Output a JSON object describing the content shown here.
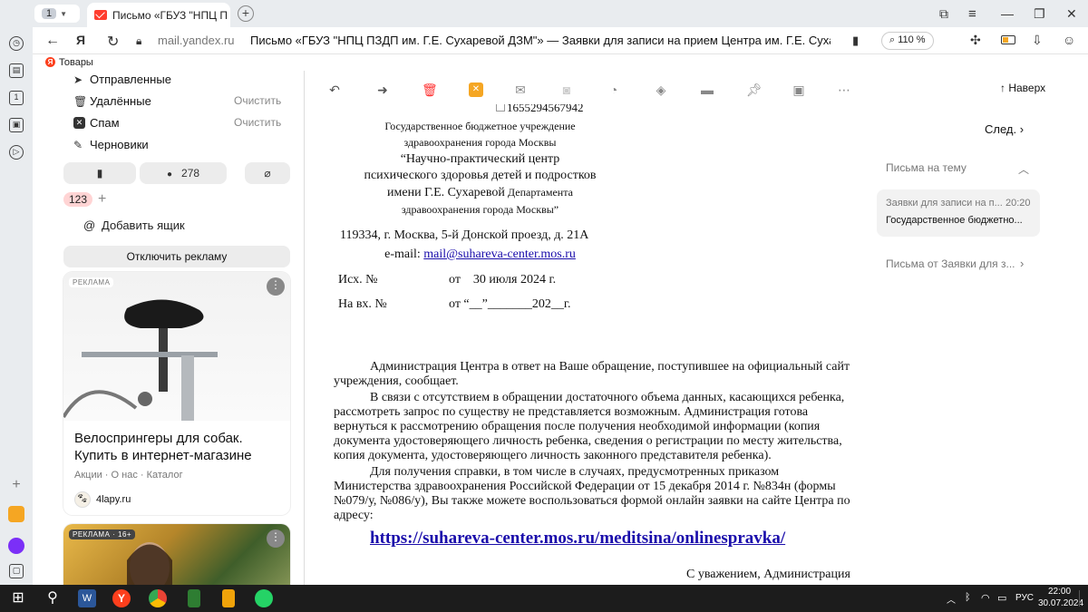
{
  "browser": {
    "tab_count": "1",
    "tab_title": "Письмо «ГБУЗ \"НПЦ П",
    "url_host": "mail.yandex.ru",
    "page_title": "Письмо «ГБУЗ \"НПЦ ПЗДП им. Г.Е. Сухаревой ДЗМ\"» — Заявки для записи на прием Центра им. Г.Е. Сухар...",
    "zoom": "110 %",
    "bookmark_label": "Товары"
  },
  "sidebar": {
    "folders": [
      {
        "label": "Отправленные",
        "icon": "send-icon"
      },
      {
        "label": "Удалённые",
        "icon": "trash-icon",
        "action": "Очистить"
      },
      {
        "label": "Спам",
        "icon": "spam-icon",
        "action": "Очистить"
      },
      {
        "label": "Черновики",
        "icon": "draft-icon"
      }
    ],
    "unread_count": "278",
    "counter_badge": "123",
    "add_box": "Добавить ящик",
    "disable_ads": "Отключить рекламу"
  },
  "ads": [
    {
      "label": "РЕКЛАМА",
      "title": "Велоспрингеры для собак. Купить в интернет-магазине",
      "links": "Акции · О нас · Каталог",
      "domain": "4lapy.ru"
    },
    {
      "label": "РЕКЛАМА · 16+"
    }
  ],
  "toolbar": {
    "up_label": "Наверх"
  },
  "letter": {
    "top_number": "1655294567942",
    "org_line1": "Государственное бюджетное учреждение",
    "org_line2": "здравоохранения города Москвы",
    "org_line3": "“Научно-практический центр",
    "org_line4": "психического здоровья детей и подростков",
    "org_line5a": "имени Г.Е. Сухаревой",
    "org_line5b": " Департамента",
    "org_line6": "здравоохранения города Москвы”",
    "address": "119334, г. Москва, 5-й Донской проезд, д. 21А",
    "email_label": "e-mail: ",
    "email": "mail@suhareva-center.mos.ru",
    "out_no": "Исх. №",
    "out_date": "от    30 июля 2024 г.",
    "in_no": "На вх. №",
    "in_date": "от “__”_______202__г.",
    "para1": "Администрация Центра в ответ на Ваше обращение, поступившее на официальный сайт",
    "para1b": "учреждения, сообщает.",
    "para2": "В связи с отсутствием в обращении достаточного объема данных, касающихся ребенка,",
    "para2b": "рассмотреть запрос по существу не представляется возможным. Администрация готова",
    "para2c": "вернуться к рассмотрению обращения после получения необходимой информации (копия",
    "para2d": "документа удостоверяющего личность ребенка, сведения о регистрации по месту жительства,",
    "para2e": "копия документа, удостоверяющего личность законного представителя ребенка).",
    "para3": "Для получения справки, в том числе в случаях, предусмотренных приказом",
    "para3b": "Министерства здравоохранения Российской Федерации от 15 декабря 2014 г. №834н (формы",
    "para3c": "№079/у, №086/у), Вы также можете воспользоваться формой онлайн заявки на сайте Центра по",
    "para3d": "адресу:",
    "link": "https://suhareva-center.mos.ru/meditsina/onlinespravka/",
    "sign": "С уважением, Администрация"
  },
  "right": {
    "next": "След.",
    "thread_header": "Письма на тему",
    "thread_item_title": "Заявки для записи на п...",
    "thread_item_time": "20:20",
    "thread_item_snippet": "Государственное бюджетно...",
    "from_header": "Письма от Заявки для з..."
  },
  "taskbar": {
    "lang": "РУС",
    "time": "22:00",
    "date": "30.07.2024"
  }
}
